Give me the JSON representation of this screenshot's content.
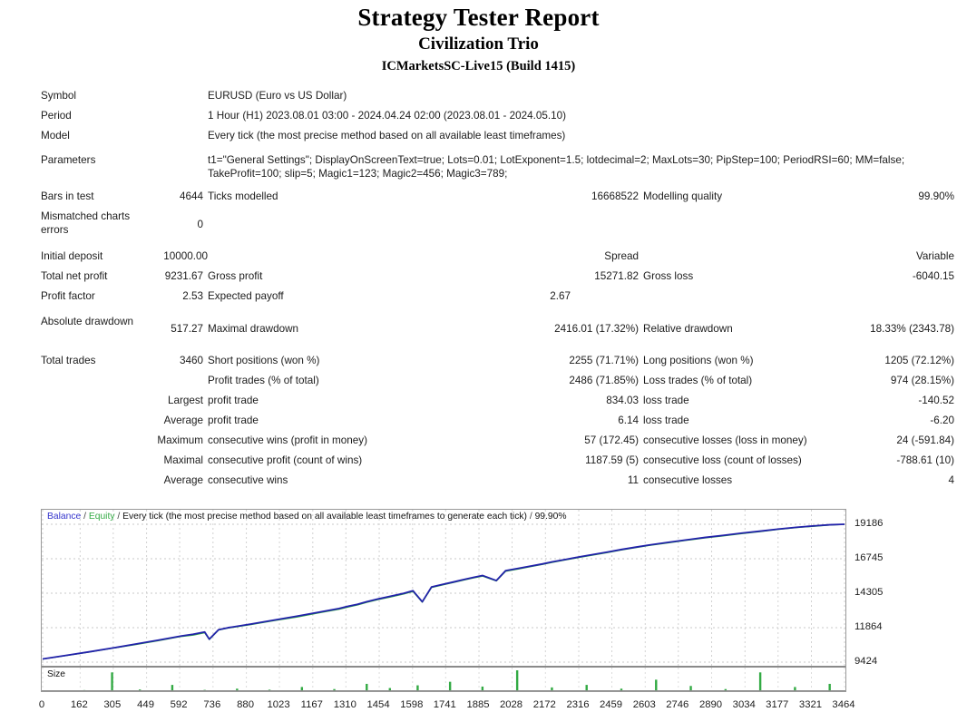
{
  "header": {
    "title": "Strategy Tester Report",
    "subtitle": "Civilization Trio",
    "server": "ICMarketsSC-Live15 (Build 1415)"
  },
  "info": {
    "symbol_label": "Symbol",
    "symbol_value": "EURUSD (Euro vs US Dollar)",
    "period_label": "Period",
    "period_value": "1 Hour (H1) 2023.08.01 03:00 - 2024.04.24 02:00 (2023.08.01 - 2024.05.10)",
    "model_label": "Model",
    "model_value": "Every tick (the most precise method based on all available least timeframes)",
    "parameters_label": "Parameters",
    "parameters_value": "t1=\"General Settings\"; DisplayOnScreenText=true; Lots=0.01; LotExponent=1.5; lotdecimal=2; MaxLots=30; PipStep=100; PeriodRSI=60; MM=false; TakeProfit=100; slip=5; Magic1=123; Magic2=456; Magic3=789;"
  },
  "stats": {
    "bars_in_test_label": "Bars in test",
    "bars_in_test_value": "4644",
    "ticks_modelled_label": "Ticks modelled",
    "ticks_modelled_value": "16668522",
    "modelling_quality_label": "Modelling quality",
    "modelling_quality_value": "99.90%",
    "mismatched_label": "Mismatched charts errors",
    "mismatched_value": "0",
    "initial_deposit_label": "Initial deposit",
    "initial_deposit_value": "10000.00",
    "spread_label": "Spread",
    "spread_value": "Variable",
    "total_net_profit_label": "Total net profit",
    "total_net_profit_value": "9231.67",
    "gross_profit_label": "Gross profit",
    "gross_profit_value": "15271.82",
    "gross_loss_label": "Gross loss",
    "gross_loss_value": "-6040.15",
    "profit_factor_label": "Profit factor",
    "profit_factor_value": "2.53",
    "expected_payoff_label": "Expected payoff",
    "expected_payoff_value": "2.67",
    "absolute_drawdown_label": "Absolute drawdown",
    "absolute_drawdown_value": "517.27",
    "maximal_drawdown_label": "Maximal drawdown",
    "maximal_drawdown_value": "2416.01 (17.32%)",
    "relative_drawdown_label": "Relative drawdown",
    "relative_drawdown_value": "18.33% (2343.78)",
    "total_trades_label": "Total trades",
    "total_trades_value": "3460",
    "short_positions_label": "Short positions (won %)",
    "short_positions_value": "2255 (71.71%)",
    "long_positions_label": "Long positions (won %)",
    "long_positions_value": "1205 (72.12%)",
    "profit_trades_label": "Profit trades (% of total)",
    "profit_trades_value": "2486 (71.85%)",
    "loss_trades_label": "Loss trades (% of total)",
    "loss_trades_value": "974 (28.15%)",
    "largest_label": "Largest",
    "largest_profit_trade_label": "profit trade",
    "largest_profit_trade_value": "834.03",
    "largest_loss_trade_label": "loss trade",
    "largest_loss_trade_value": "-140.52",
    "average_label": "Average",
    "average_profit_trade_label": "profit trade",
    "average_profit_trade_value": "6.14",
    "average_loss_trade_label": "loss trade",
    "average_loss_trade_value": "-6.20",
    "maximum_label": "Maximum",
    "max_consecutive_wins_label": "consecutive wins (profit in money)",
    "max_consecutive_wins_value": "57 (172.45)",
    "max_consecutive_losses_label": "consecutive losses (loss in money)",
    "max_consecutive_losses_value": "24 (-591.84)",
    "maximal_label": "Maximal",
    "maximal_consecutive_profit_label": "consecutive profit (count of wins)",
    "maximal_consecutive_profit_value": "1187.59 (5)",
    "maximal_consecutive_loss_label": "consecutive loss (count of losses)",
    "maximal_consecutive_loss_value": "-788.61 (10)",
    "average2_label": "Average",
    "avg_consecutive_wins_label": "consecutive wins",
    "avg_consecutive_wins_value": "11",
    "avg_consecutive_losses_label": "consecutive losses",
    "avg_consecutive_losses_value": "4"
  },
  "chart": {
    "legend_balance": "Balance",
    "legend_equity": "Equity",
    "legend_sep1": "/",
    "legend_sep2": "/",
    "legend_model": "Every tick (the most precise method based on all available least timeframes to generate each tick)",
    "legend_sep3": "/",
    "legend_quality": "99.90%",
    "size_label": "Size",
    "balance_color": "#2222aa",
    "equity_color": "#33aa44"
  },
  "chart_data": {
    "type": "line",
    "title": "Balance / Equity / Every tick (the most precise method based on all available least timeframes to generate each tick) / 99.90%",
    "xlabel": "",
    "ylabel": "",
    "grid": true,
    "legend_position": "top-left",
    "ylim": [
      9424,
      19186
    ],
    "yticks": [
      9424,
      11864,
      14305,
      16745,
      19186
    ],
    "xlim": [
      0,
      3464
    ],
    "xticks": [
      0,
      162,
      305,
      449,
      592,
      736,
      880,
      1023,
      1167,
      1310,
      1454,
      1598,
      1741,
      1885,
      2028,
      2172,
      2316,
      2459,
      2603,
      2746,
      2890,
      3034,
      3177,
      3321,
      3464
    ],
    "series": [
      {
        "name": "Balance",
        "color": "#2222aa",
        "x": [
          0,
          100,
          200,
          300,
          400,
          500,
          600,
          650,
          700,
          720,
          760,
          800,
          900,
          1000,
          1100,
          1200,
          1280,
          1320,
          1360,
          1400,
          1450,
          1500,
          1560,
          1600,
          1640,
          1680,
          1720,
          1780,
          1820,
          1860,
          1900,
          1960,
          2000,
          2060,
          2100,
          2160,
          2200,
          2260,
          2320,
          2380,
          2440,
          2500,
          2560,
          2620,
          2700,
          2780,
          2860,
          2940,
          3020,
          3100,
          3180,
          3260,
          3340,
          3400,
          3464
        ],
        "y": [
          9650,
          9900,
          10150,
          10420,
          10700,
          10980,
          11280,
          11400,
          11560,
          11050,
          11720,
          11860,
          12120,
          12400,
          12680,
          12980,
          13220,
          13380,
          13520,
          13700,
          13900,
          14080,
          14300,
          14480,
          13700,
          14750,
          14900,
          15120,
          15280,
          15420,
          15560,
          15200,
          15900,
          16080,
          16200,
          16380,
          16520,
          16700,
          16880,
          17050,
          17220,
          17400,
          17560,
          17720,
          17900,
          18080,
          18250,
          18400,
          18560,
          18700,
          18850,
          18980,
          19080,
          19150,
          19186
        ]
      },
      {
        "name": "Equity",
        "color": "#33aa44",
        "x": [
          0,
          100,
          200,
          300,
          400,
          500,
          600,
          650,
          700,
          720,
          760,
          800,
          900,
          1000,
          1100,
          1200,
          1280,
          1320,
          1360,
          1400,
          1450,
          1500,
          1560,
          1600,
          1640,
          1680,
          1720,
          1780,
          1820,
          1860,
          1900,
          1960,
          2000,
          2060,
          2100,
          2160,
          2200,
          2260,
          2320,
          2380,
          2440,
          2500,
          2560,
          2620,
          2700,
          2780,
          2860,
          2940,
          3020,
          3100,
          3180,
          3260,
          3340,
          3400,
          3464
        ],
        "y": [
          9640,
          9880,
          10130,
          10400,
          10660,
          10940,
          11240,
          11330,
          11500,
          11020,
          11690,
          11830,
          12080,
          12360,
          12620,
          12930,
          13160,
          13320,
          13470,
          13650,
          13850,
          14020,
          14250,
          14420,
          13660,
          14700,
          14860,
          15080,
          15230,
          15380,
          15510,
          15170,
          15850,
          16030,
          16160,
          16340,
          16480,
          16660,
          16840,
          17010,
          17180,
          17360,
          17520,
          17680,
          17860,
          18040,
          18210,
          18360,
          18520,
          18660,
          18820,
          18950,
          19050,
          19130,
          19180
        ]
      }
    ],
    "size_series": {
      "name": "Size",
      "color": "#33aa44",
      "x": [
        180,
        300,
        420,
        560,
        700,
        840,
        980,
        1120,
        1260,
        1400,
        1500,
        1620,
        1760,
        1900,
        2050,
        2200,
        2350,
        2500,
        2650,
        2800,
        2950,
        3100,
        3250,
        3400
      ],
      "y": [
        0.05,
        0.9,
        0.08,
        0.3,
        0.06,
        0.12,
        0.07,
        0.2,
        0.1,
        0.35,
        0.15,
        0.28,
        0.45,
        0.22,
        1.0,
        0.18,
        0.3,
        0.12,
        0.55,
        0.25,
        0.1,
        0.9,
        0.2,
        0.35
      ]
    }
  }
}
